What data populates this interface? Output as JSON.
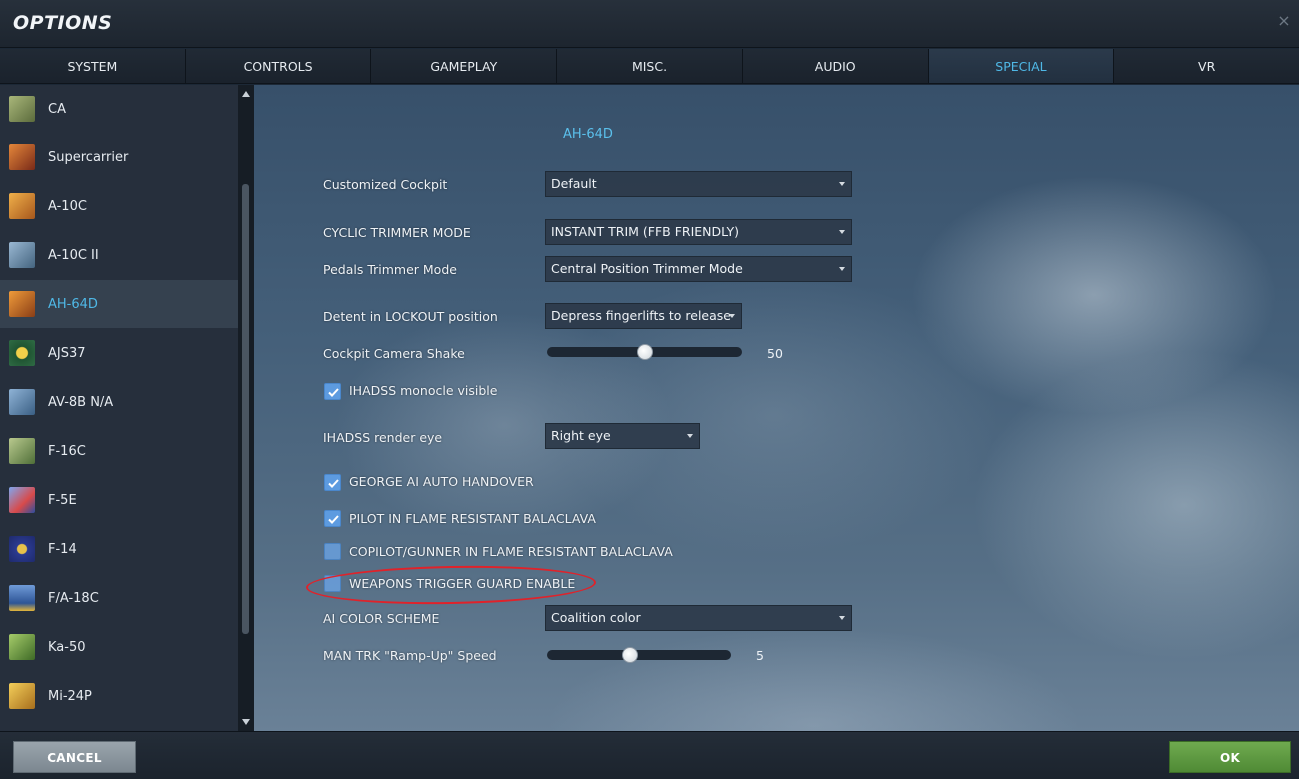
{
  "window": {
    "title": "OPTIONS",
    "close_glyph": "×"
  },
  "tabs": [
    {
      "label": "SYSTEM",
      "active": false
    },
    {
      "label": "CONTROLS",
      "active": false
    },
    {
      "label": "GAMEPLAY",
      "active": false
    },
    {
      "label": "MISC.",
      "active": false
    },
    {
      "label": "AUDIO",
      "active": false
    },
    {
      "label": "SPECIAL",
      "active": true
    },
    {
      "label": "VR",
      "active": false
    }
  ],
  "sidebar": {
    "items": [
      {
        "label": "CA",
        "icon": "ca-module-icon",
        "color": "#7a8a55"
      },
      {
        "label": "Supercarrier",
        "icon": "supercarrier-module-icon",
        "color": "#c0552e"
      },
      {
        "label": "A-10C",
        "icon": "a10c-module-icon",
        "color": "#d9892c"
      },
      {
        "label": "A-10C II",
        "icon": "a10c2-module-icon",
        "color": "#6c8fb0"
      },
      {
        "label": "AH-64D",
        "icon": "ah64d-module-icon",
        "color": "#d0762a",
        "active": true
      },
      {
        "label": "AJS37",
        "icon": "ajs37-module-icon",
        "color": "#2f6c44"
      },
      {
        "label": "AV-8B N/A",
        "icon": "av8b-module-icon",
        "color": "#5b86ad"
      },
      {
        "label": "F-16C",
        "icon": "f16c-module-icon",
        "color": "#7b9a5e"
      },
      {
        "label": "F-5E",
        "icon": "f5e-module-icon",
        "color": "#4a74c9"
      },
      {
        "label": "F-14",
        "icon": "f14-module-icon",
        "color": "#3c4ea8"
      },
      {
        "label": "F/A-18C",
        "icon": "fa18c-module-icon",
        "color": "#3f6fb5"
      },
      {
        "label": "Ka-50",
        "icon": "ka50-module-icon",
        "color": "#6f9a45"
      },
      {
        "label": "Mi-24P",
        "icon": "mi24p-module-icon",
        "color": "#d4a02e"
      }
    ]
  },
  "main": {
    "section_title": "AH-64D",
    "customized_cockpit": {
      "label": "Customized Cockpit",
      "value": "Default"
    },
    "cyclic_trimmer": {
      "label": "CYCLIC TRIMMER MODE",
      "value": "INSTANT TRIM (FFB FRIENDLY)"
    },
    "pedals_trimmer": {
      "label": "Pedals Trimmer Mode",
      "value": "Central Position Trimmer Mode"
    },
    "detent_lockout": {
      "label": "Detent in LOCKOUT position",
      "value": "Depress fingerlifts to release"
    },
    "camera_shake": {
      "label": "Cockpit Camera Shake",
      "value": "50",
      "level": 0.5
    },
    "ihadss_monocle": {
      "label": "IHADSS monocle visible",
      "checked": true
    },
    "ihadss_eye": {
      "label": "IHADSS render eye",
      "value": "Right eye"
    },
    "george_handover": {
      "label": "GEORGE AI AUTO HANDOVER",
      "checked": true
    },
    "pilot_balaclava": {
      "label": "PILOT IN FLAME RESISTANT BALACLAVA",
      "checked": true
    },
    "copilot_balaclava": {
      "label": "COPILOT/GUNNER IN FLAME RESISTANT BALACLAVA",
      "checked": false
    },
    "trigger_guard": {
      "label": "WEAPONS TRIGGER GUARD ENABLE",
      "checked": false
    },
    "ai_color": {
      "label": "AI COLOR SCHEME",
      "value": "Coalition color"
    },
    "ramp_up": {
      "label": "MAN TRK \"Ramp-Up\" Speed",
      "value": "5",
      "level": 0.45
    }
  },
  "footer": {
    "cancel_label": "CANCEL",
    "ok_label": "OK"
  },
  "colors": {
    "accent": "#4fb8e6",
    "ok_button": "#5f9b42",
    "cancel_button": "#8a959e",
    "highlight_annotation": "#e0222a"
  }
}
